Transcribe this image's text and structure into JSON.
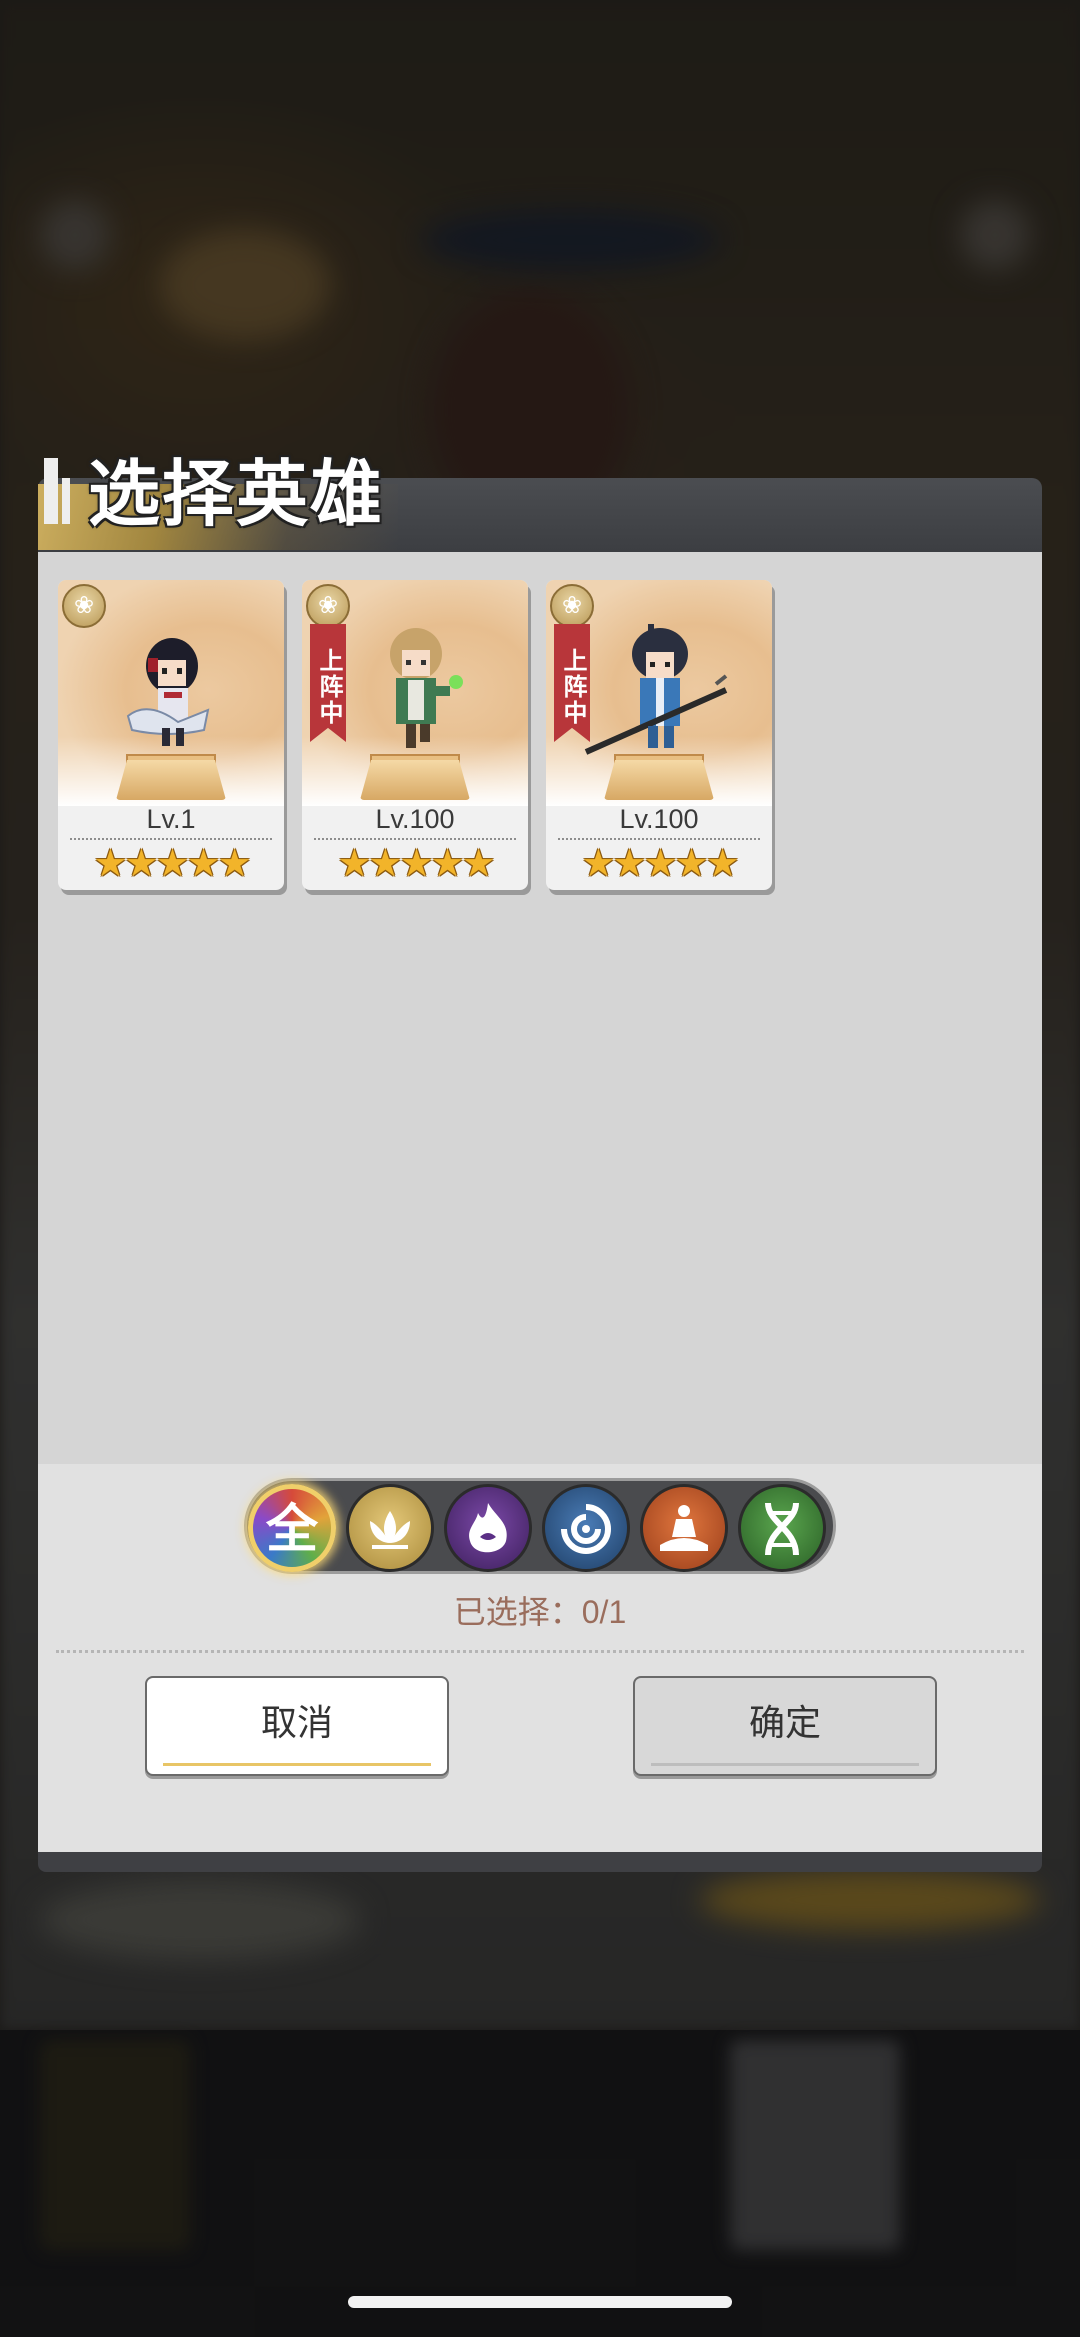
{
  "modal": {
    "title": "选择英雄"
  },
  "heroes": [
    {
      "level": "Lv.1",
      "stars": "★★★★★",
      "star_count": 5,
      "deployed_label": "",
      "outfit_color": "#e6e6ef",
      "hair_color": "#1d1d2a"
    },
    {
      "level": "Lv.100",
      "stars": "★★★★★",
      "star_count": 5,
      "deployed_label": "上阵中",
      "outfit_color": "#3f7a52",
      "hair_color": "#c7a36a"
    },
    {
      "level": "Lv.100",
      "stars": "★★★★★",
      "star_count": 5,
      "deployed_label": "上阵中",
      "outfit_color": "#3a78b8",
      "hair_color": "#2a2f3f"
    }
  ],
  "filters": [
    {
      "label": "全",
      "icon": "all-icon",
      "color": "#7a5a2a",
      "active": true
    },
    {
      "label": "",
      "icon": "lotus-icon",
      "color": "#b9963e",
      "active": false
    },
    {
      "label": "",
      "icon": "flame-icon",
      "color": "#5b2f86",
      "active": false
    },
    {
      "label": "",
      "icon": "swirl-icon",
      "color": "#2f5f94",
      "active": false
    },
    {
      "label": "",
      "icon": "meditation-icon",
      "color": "#c85a2a",
      "active": false
    },
    {
      "label": "",
      "icon": "dna-icon",
      "color": "#3e8a3a",
      "active": false
    }
  ],
  "selection": {
    "text": "已选择：0/1"
  },
  "buttons": {
    "cancel": "取消",
    "confirm": "确定"
  }
}
